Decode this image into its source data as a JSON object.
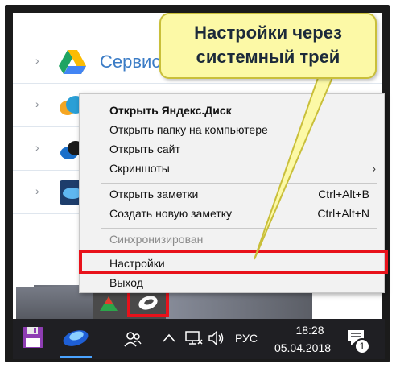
{
  "background_app": {
    "rows": [
      {
        "label": "Сервис"
      },
      {
        "label": ""
      },
      {
        "label": ""
      },
      {
        "label": ""
      }
    ]
  },
  "callout": {
    "line1": "Настройки через",
    "line2": "системный трей"
  },
  "context_menu": {
    "items": [
      {
        "label": "Открыть Яндекс.Диск",
        "bold": true
      },
      {
        "label": "Открыть папку на компьютере"
      },
      {
        "label": "Открыть сайт"
      },
      {
        "label": "Скриншоты",
        "submenu": true
      },
      {
        "label": "Открыть заметки",
        "shortcut": "Ctrl+Alt+B"
      },
      {
        "label": "Создать новую заметку",
        "shortcut": "Ctrl+Alt+N"
      },
      {
        "label": "Синхронизирован",
        "disabled": true
      },
      {
        "label": "Настройки"
      },
      {
        "label": "Выход"
      }
    ],
    "submenu_arrow": "›"
  },
  "taskbar": {
    "language": "РУС",
    "time": "18:28",
    "date": "05.04.2018",
    "notification_count": "1",
    "icons": [
      "save-icon",
      "yandex-disk-app-icon",
      "people-icon",
      "chevron-up-icon",
      "network-icon",
      "volume-icon",
      "notification-icon"
    ]
  },
  "colors": {
    "highlight": "#e8121b",
    "callout_bg": "#fcf9a6",
    "accent_text": "#3b7cc6",
    "taskbar": "#1f1f23"
  }
}
